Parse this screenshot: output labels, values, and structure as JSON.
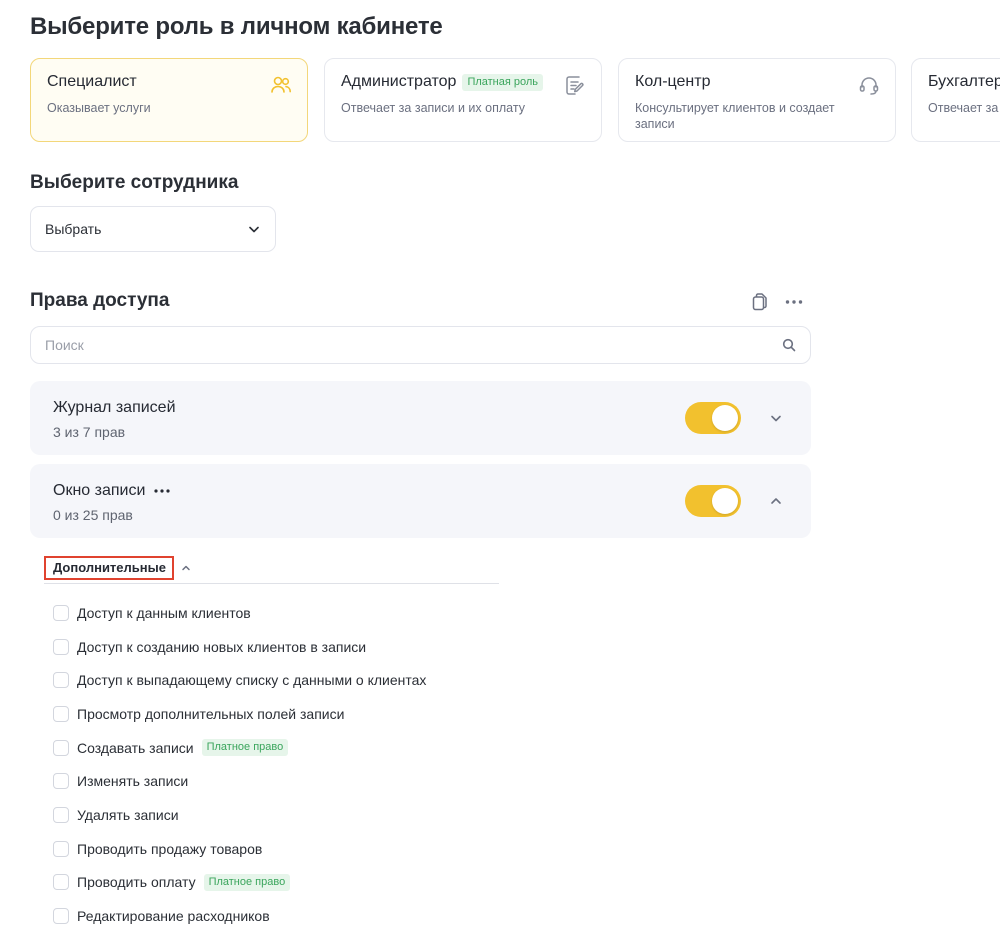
{
  "page_title": "Выберите роль в личном кабинете",
  "roles": [
    {
      "title": "Специалист",
      "badge": "",
      "description": "Оказывает услуги",
      "icon": "users-icon",
      "selected": true
    },
    {
      "title": "Администратор",
      "badge": "Платная роль",
      "description": "Отвечает за записи и их оплату",
      "icon": "edit-document-icon",
      "selected": false
    },
    {
      "title": "Кол-центр",
      "badge": "",
      "description": "Консультирует клиентов и создает записи",
      "icon": "headset-icon",
      "selected": false
    },
    {
      "title": "Бухгалтер",
      "badge": "",
      "description": "Отвечает за",
      "icon": "",
      "selected": false
    }
  ],
  "employee": {
    "heading": "Выберите сотрудника",
    "select_value": "Выбрать"
  },
  "access": {
    "heading": "Права доступа",
    "search_placeholder": "Поиск",
    "groups": [
      {
        "title": "Журнал записей",
        "subtitle": "3 из 7 прав",
        "enabled": true,
        "expanded": false
      },
      {
        "title": "Окно записи",
        "subtitle": "0 из 25 прав",
        "enabled": true,
        "expanded": true
      }
    ],
    "section_label": "Дополнительные",
    "permissions": [
      {
        "label": "Доступ к данным клиентов",
        "badge": "",
        "checked": false
      },
      {
        "label": "Доступ к созданию новых клиентов в записи",
        "badge": "",
        "checked": false
      },
      {
        "label": "Доступ к выпадающему списку с данными о клиентах",
        "badge": "",
        "checked": false
      },
      {
        "label": "Просмотр дополнительных полей записи",
        "badge": "",
        "checked": false
      },
      {
        "label": "Создавать записи",
        "badge": "Платное право",
        "checked": false
      },
      {
        "label": "Изменять записи",
        "badge": "",
        "checked": false
      },
      {
        "label": "Удалять записи",
        "badge": "",
        "checked": false
      },
      {
        "label": "Проводить продажу товаров",
        "badge": "",
        "checked": false
      },
      {
        "label": "Проводить оплату",
        "badge": "Платное право",
        "checked": false
      },
      {
        "label": "Редактирование расходников",
        "badge": "",
        "checked": false
      }
    ]
  },
  "colors": {
    "accent": "#f2c12e",
    "selected_card_border": "#f3d77a",
    "badge_green": "#3aa55c",
    "highlight_red": "#e0432f"
  }
}
